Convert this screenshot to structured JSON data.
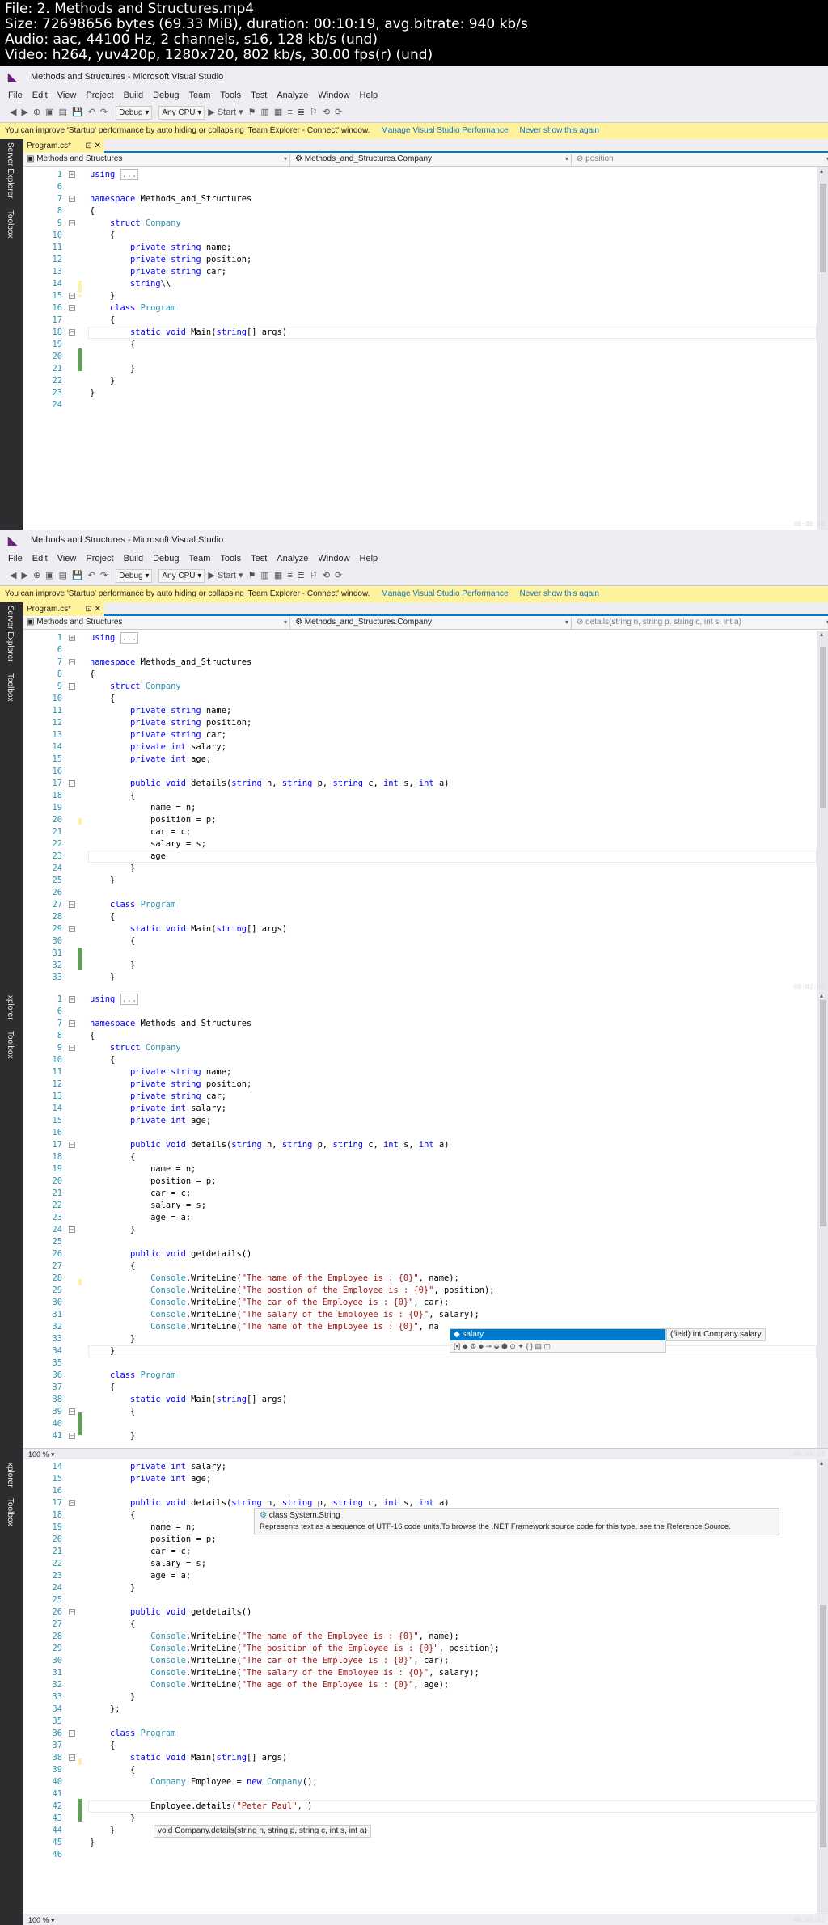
{
  "header": {
    "lines": [
      "File: 2. Methods and Structures.mp4",
      "Size: 72698656 bytes (69.33 MiB), duration: 00:10:19, avg.bitrate: 940 kb/s",
      "Audio: aac, 44100 Hz, 2 channels, s16, 128 kb/s (und)",
      "Video: h264, yuv420p, 1280x720, 802 kb/s, 30.00 fps(r) (und)"
    ]
  },
  "window": {
    "title": "Methods and Structures - Microsoft Visual Studio",
    "menu": [
      "File",
      "Edit",
      "View",
      "Project",
      "Build",
      "Debug",
      "Team",
      "Tools",
      "Test",
      "Analyze",
      "Window",
      "Help"
    ],
    "config": "Debug",
    "platform": "Any CPU",
    "start": "▶ Start ▾",
    "infobar": {
      "text": "You can improve 'Startup' performance by auto hiding or collapsing 'Team Explorer - Connect' window.",
      "link1": "Manage Visual Studio Performance",
      "link2": "Never show this again"
    },
    "side_tabs": [
      "Server Explorer",
      "Toolbox"
    ],
    "side_tabs_short": [
      "xplorer",
      "Toolbox"
    ],
    "doc_tab": "Program.cs*",
    "nav_project": "Methods and Structures",
    "nav_class": "Methods_and_Structures.Company",
    "zoom": "100 %"
  },
  "frames": [
    {
      "nav_member": "position",
      "timestamp": "00:00:24",
      "lines": [
        [
          "1",
          "using ..."
        ],
        [
          "6",
          ""
        ],
        [
          "7",
          "namespace Methods_and_Structures"
        ],
        [
          "8",
          "{"
        ],
        [
          "9",
          "    struct Company"
        ],
        [
          "10",
          "    {"
        ],
        [
          "11",
          "        private string name;"
        ],
        [
          "12",
          "        private string position;"
        ],
        [
          "13",
          "        private string car;"
        ],
        [
          "14",
          "        string\\\\"
        ],
        [
          "15",
          "    }"
        ],
        [
          "16",
          "    class Program"
        ],
        [
          "17",
          "    {"
        ],
        [
          "18",
          "        static void Main(string[] args)"
        ],
        [
          "19",
          "        {"
        ],
        [
          "20",
          ""
        ],
        [
          "21",
          "        }"
        ],
        [
          "22",
          "    }"
        ],
        [
          "23",
          "}"
        ],
        [
          "24",
          ""
        ]
      ]
    },
    {
      "nav_member": "details(string n, string p, string c, int s, int a)",
      "timestamp": "00:02:00",
      "lines": [
        [
          "1",
          "using ..."
        ],
        [
          "6",
          ""
        ],
        [
          "7",
          "namespace Methods_and_Structures"
        ],
        [
          "8",
          "{"
        ],
        [
          "9",
          "    struct Company"
        ],
        [
          "10",
          "    {"
        ],
        [
          "11",
          "        private string name;"
        ],
        [
          "12",
          "        private string position;"
        ],
        [
          "13",
          "        private string car;"
        ],
        [
          "14",
          "        private int salary;"
        ],
        [
          "15",
          "        private int age;"
        ],
        [
          "16",
          ""
        ],
        [
          "17",
          "        public void details(string n, string p, string c, int s, int a)"
        ],
        [
          "18",
          "        {"
        ],
        [
          "19",
          "            name = n;"
        ],
        [
          "20",
          "            position = p;"
        ],
        [
          "21",
          "            car = c;"
        ],
        [
          "22",
          "            salary = s;"
        ],
        [
          "23",
          "            age"
        ],
        [
          "24",
          "        }"
        ],
        [
          "25",
          "    }"
        ],
        [
          "26",
          ""
        ],
        [
          "27",
          "    class Program"
        ],
        [
          "28",
          "    {"
        ],
        [
          "29",
          "        static void Main(string[] args)"
        ],
        [
          "30",
          "        {"
        ],
        [
          "31",
          ""
        ],
        [
          "32",
          "        }"
        ],
        [
          "33",
          "    }"
        ]
      ]
    },
    {
      "timestamp": "00:04:08",
      "intellisense": {
        "item": "salary",
        "tooltip": "(field) int Company.salary"
      },
      "lines": [
        [
          "1",
          "using ..."
        ],
        [
          "6",
          ""
        ],
        [
          "7",
          "namespace Methods_and_Structures"
        ],
        [
          "8",
          "{"
        ],
        [
          "9",
          "    struct Company"
        ],
        [
          "10",
          "    {"
        ],
        [
          "11",
          "        private string name;"
        ],
        [
          "12",
          "        private string position;"
        ],
        [
          "13",
          "        private string car;"
        ],
        [
          "14",
          "        private int salary;"
        ],
        [
          "15",
          "        private int age;"
        ],
        [
          "16",
          ""
        ],
        [
          "17",
          "        public void details(string n, string p, string c, int s, int a)"
        ],
        [
          "18",
          "        {"
        ],
        [
          "19",
          "            name = n;"
        ],
        [
          "20",
          "            position = p;"
        ],
        [
          "21",
          "            car = c;"
        ],
        [
          "22",
          "            salary = s;"
        ],
        [
          "23",
          "            age = a;"
        ],
        [
          "24",
          "        }"
        ],
        [
          "25",
          ""
        ],
        [
          "26",
          "        public void getdetails()"
        ],
        [
          "27",
          "        {"
        ],
        [
          "28",
          "            Console.WriteLine(\"The name of the Employee is : {0}\", name);"
        ],
        [
          "29",
          "            Console.WriteLine(\"The postion of the Employee is : {0}\", position);"
        ],
        [
          "30",
          "            Console.WriteLine(\"The car of the Employee is : {0}\", car);"
        ],
        [
          "31",
          "            Console.WriteLine(\"The salary of the Employee is : {0}\", salary);"
        ],
        [
          "32",
          "            Console.WriteLine(\"The name of the Employee is : {0}\", na"
        ],
        [
          "33",
          "        }"
        ],
        [
          "34",
          "    }"
        ],
        [
          "35",
          ""
        ],
        [
          "36",
          "    class Program"
        ],
        [
          "37",
          "    {"
        ],
        [
          "38",
          "        static void Main(string[] args)"
        ],
        [
          "39",
          "        {"
        ],
        [
          "40",
          ""
        ],
        [
          "41",
          "        }"
        ]
      ]
    },
    {
      "timestamp": "00:06:12",
      "quickinfo": {
        "title": "class System.String",
        "desc": "Represents text as a sequence of UTF-16 code units.To browse the .NET Framework source code for this type, see the Reference Source."
      },
      "sighelp": "void Company.details(string n, string p, string c, int s, int a)",
      "lines": [
        [
          "14",
          "        private int salary;"
        ],
        [
          "15",
          "        private int age;"
        ],
        [
          "16",
          ""
        ],
        [
          "17",
          "        public void details(string n, string p, string c, int s, int a)"
        ],
        [
          "18",
          "        {"
        ],
        [
          "19",
          "            name = n;"
        ],
        [
          "20",
          "            position = p;"
        ],
        [
          "21",
          "            car = c;"
        ],
        [
          "22",
          "            salary = s;"
        ],
        [
          "23",
          "            age = a;"
        ],
        [
          "24",
          "        }"
        ],
        [
          "25",
          ""
        ],
        [
          "26",
          "        public void getdetails()"
        ],
        [
          "27",
          "        {"
        ],
        [
          "28",
          "            Console.WriteLine(\"The name of the Employee is : {0}\", name);"
        ],
        [
          "29",
          "            Console.WriteLine(\"The position of the Employee is : {0}\", position);"
        ],
        [
          "30",
          "            Console.WriteLine(\"The car of the Employee is : {0}\", car);"
        ],
        [
          "31",
          "            Console.WriteLine(\"The salary of the Employee is : {0}\", salary);"
        ],
        [
          "32",
          "            Console.WriteLine(\"The age of the Employee is : {0}\", age);"
        ],
        [
          "33",
          "        }"
        ],
        [
          "34",
          "    };"
        ],
        [
          "35",
          ""
        ],
        [
          "36",
          "    class Program"
        ],
        [
          "37",
          "    {"
        ],
        [
          "38",
          "        static void Main(string[] args)"
        ],
        [
          "39",
          "        {"
        ],
        [
          "40",
          "            Company Employee = new Company();"
        ],
        [
          "41",
          ""
        ],
        [
          "42",
          "            Employee.details(\"Peter Paul\", )"
        ],
        [
          "43",
          "        }"
        ],
        [
          "44",
          "    }"
        ],
        [
          "45",
          "}"
        ],
        [
          "46",
          ""
        ]
      ]
    }
  ]
}
